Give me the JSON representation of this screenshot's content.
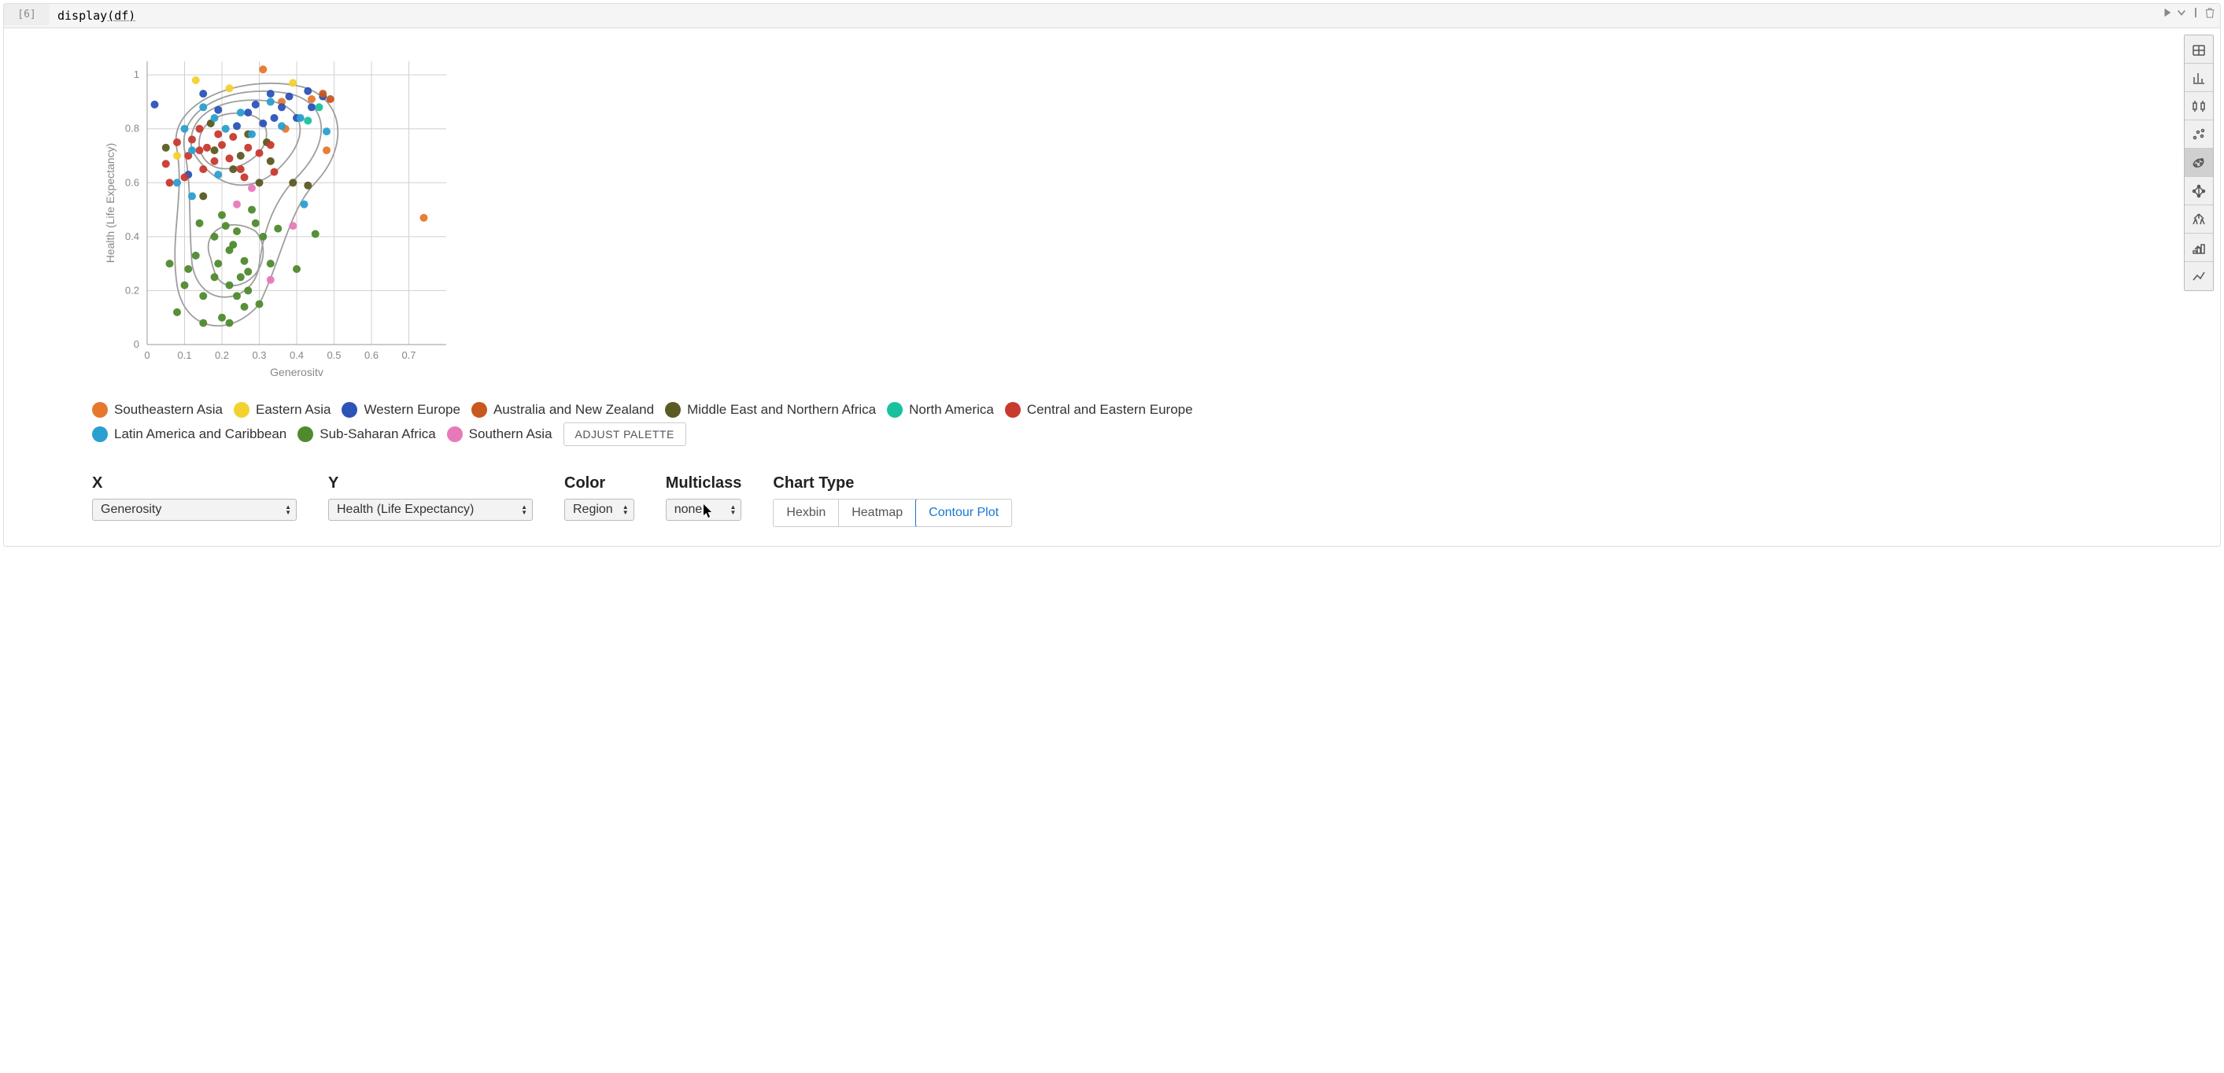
{
  "cell": {
    "prompt": "[6]",
    "code_pre": "display",
    "code_arg": "(df)"
  },
  "chart_data": {
    "type": "scatter",
    "xlabel": "Generositv",
    "ylabel": "Health (Life Expectancy)",
    "xlim": [
      0,
      0.8
    ],
    "ylim": [
      0,
      1.05
    ],
    "xticks": [
      0,
      0.1,
      0.2,
      0.3,
      0.4,
      0.5,
      0.6,
      0.7
    ],
    "yticks": [
      0,
      0.2,
      0.4,
      0.6,
      0.8,
      1
    ],
    "series": [
      {
        "name": "Southeastern Asia",
        "color": "#e6782e",
        "points": [
          [
            0.31,
            1.02
          ],
          [
            0.36,
            0.9
          ],
          [
            0.44,
            0.91
          ],
          [
            0.74,
            0.47
          ],
          [
            0.48,
            0.72
          ],
          [
            0.37,
            0.8
          ]
        ]
      },
      {
        "name": "Eastern Asia",
        "color": "#f2d22e",
        "points": [
          [
            0.13,
            0.98
          ],
          [
            0.08,
            0.7
          ],
          [
            0.39,
            0.97
          ],
          [
            0.22,
            0.95
          ]
        ]
      },
      {
        "name": "Western Europe",
        "color": "#2b53b8",
        "points": [
          [
            0.29,
            0.89
          ],
          [
            0.33,
            0.93
          ],
          [
            0.38,
            0.92
          ],
          [
            0.43,
            0.94
          ],
          [
            0.36,
            0.88
          ],
          [
            0.47,
            0.92
          ],
          [
            0.27,
            0.86
          ],
          [
            0.34,
            0.84
          ],
          [
            0.11,
            0.63
          ],
          [
            0.02,
            0.89
          ],
          [
            0.15,
            0.93
          ],
          [
            0.19,
            0.87
          ],
          [
            0.24,
            0.81
          ],
          [
            0.31,
            0.82
          ],
          [
            0.4,
            0.84
          ],
          [
            0.44,
            0.88
          ]
        ]
      },
      {
        "name": "Australia and New Zealand",
        "color": "#c9571e",
        "points": [
          [
            0.47,
            0.93
          ],
          [
            0.49,
            0.91
          ]
        ]
      },
      {
        "name": "Middle East and Northern Africa",
        "color": "#5b5a22",
        "points": [
          [
            0.17,
            0.82
          ],
          [
            0.15,
            0.55
          ],
          [
            0.32,
            0.75
          ],
          [
            0.25,
            0.7
          ],
          [
            0.39,
            0.6
          ],
          [
            0.3,
            0.6
          ],
          [
            0.23,
            0.65
          ],
          [
            0.18,
            0.72
          ],
          [
            0.27,
            0.78
          ],
          [
            0.43,
            0.59
          ],
          [
            0.33,
            0.68
          ],
          [
            0.05,
            0.73
          ]
        ]
      },
      {
        "name": "North America",
        "color": "#19c29d",
        "points": [
          [
            0.43,
            0.83
          ],
          [
            0.46,
            0.88
          ]
        ]
      },
      {
        "name": "Central and Eastern Europe",
        "color": "#c73a2e",
        "points": [
          [
            0.05,
            0.67
          ],
          [
            0.08,
            0.75
          ],
          [
            0.12,
            0.76
          ],
          [
            0.14,
            0.72
          ],
          [
            0.16,
            0.73
          ],
          [
            0.23,
            0.77
          ],
          [
            0.2,
            0.74
          ],
          [
            0.27,
            0.73
          ],
          [
            0.1,
            0.62
          ],
          [
            0.15,
            0.65
          ],
          [
            0.18,
            0.68
          ],
          [
            0.22,
            0.69
          ],
          [
            0.25,
            0.65
          ],
          [
            0.3,
            0.71
          ],
          [
            0.33,
            0.74
          ],
          [
            0.11,
            0.7
          ],
          [
            0.06,
            0.6
          ],
          [
            0.14,
            0.8
          ],
          [
            0.19,
            0.78
          ],
          [
            0.26,
            0.62
          ],
          [
            0.34,
            0.64
          ]
        ]
      },
      {
        "name": "Latin America and Caribbean",
        "color": "#2a9fd1",
        "points": [
          [
            0.1,
            0.8
          ],
          [
            0.15,
            0.88
          ],
          [
            0.18,
            0.84
          ],
          [
            0.08,
            0.6
          ],
          [
            0.12,
            0.55
          ],
          [
            0.25,
            0.86
          ],
          [
            0.33,
            0.9
          ],
          [
            0.19,
            0.63
          ],
          [
            0.28,
            0.78
          ],
          [
            0.36,
            0.81
          ],
          [
            0.48,
            0.79
          ],
          [
            0.41,
            0.84
          ],
          [
            0.42,
            0.52
          ],
          [
            0.12,
            0.72
          ],
          [
            0.21,
            0.8
          ]
        ]
      },
      {
        "name": "Sub-Saharan Africa",
        "color": "#4f8a2f",
        "points": [
          [
            0.19,
            0.3
          ],
          [
            0.22,
            0.35
          ],
          [
            0.26,
            0.31
          ],
          [
            0.24,
            0.42
          ],
          [
            0.18,
            0.25
          ],
          [
            0.15,
            0.18
          ],
          [
            0.29,
            0.45
          ],
          [
            0.33,
            0.3
          ],
          [
            0.3,
            0.15
          ],
          [
            0.2,
            0.1
          ],
          [
            0.08,
            0.12
          ],
          [
            0.1,
            0.22
          ],
          [
            0.13,
            0.33
          ],
          [
            0.27,
            0.2
          ],
          [
            0.31,
            0.4
          ],
          [
            0.35,
            0.43
          ],
          [
            0.4,
            0.28
          ],
          [
            0.45,
            0.41
          ],
          [
            0.22,
            0.08
          ],
          [
            0.25,
            0.25
          ],
          [
            0.18,
            0.4
          ],
          [
            0.21,
            0.44
          ],
          [
            0.23,
            0.37
          ],
          [
            0.26,
            0.14
          ],
          [
            0.11,
            0.28
          ],
          [
            0.14,
            0.45
          ],
          [
            0.28,
            0.5
          ],
          [
            0.2,
            0.48
          ],
          [
            0.24,
            0.18
          ],
          [
            0.27,
            0.27
          ],
          [
            0.22,
            0.22
          ],
          [
            0.15,
            0.08
          ],
          [
            0.06,
            0.3
          ]
        ]
      },
      {
        "name": "Southern Asia",
        "color": "#e879b9",
        "points": [
          [
            0.24,
            0.52
          ],
          [
            0.28,
            0.58
          ],
          [
            0.39,
            0.44
          ],
          [
            0.33,
            0.24
          ]
        ]
      }
    ],
    "contours": true
  },
  "legend": {
    "items": [
      {
        "label": "Southeastern Asia",
        "color": "#e6782e"
      },
      {
        "label": "Eastern Asia",
        "color": "#f2d22e"
      },
      {
        "label": "Western Europe",
        "color": "#2b53b8"
      },
      {
        "label": "Australia and New Zealand",
        "color": "#c9571e"
      },
      {
        "label": "Middle East and Northern Africa",
        "color": "#5b5a22"
      },
      {
        "label": "North America",
        "color": "#19c29d"
      },
      {
        "label": "Central and Eastern Europe",
        "color": "#c73a2e"
      },
      {
        "label": "Latin America and Caribbean",
        "color": "#2a9fd1"
      },
      {
        "label": "Sub-Saharan Africa",
        "color": "#4f8a2f"
      },
      {
        "label": "Southern Asia",
        "color": "#e879b9"
      }
    ],
    "adjust_label": "ADJUST PALETTE"
  },
  "controls": {
    "x_label": "X",
    "x_value": "Generosity",
    "y_label": "Y",
    "y_value": "Health (Life Expectancy)",
    "color_label": "Color",
    "color_value": "Region",
    "multiclass_label": "Multiclass",
    "multiclass_value": "none",
    "chart_type_label": "Chart Type",
    "chart_types": [
      "Hexbin",
      "Heatmap",
      "Contour Plot"
    ],
    "chart_type_selected": "Contour Plot"
  },
  "toolbar": {
    "items": [
      {
        "name": "data-table-icon"
      },
      {
        "name": "bar-chart-icon"
      },
      {
        "name": "boxplot-icon"
      },
      {
        "name": "scatter-icon"
      },
      {
        "name": "contour-scatter-icon"
      },
      {
        "name": "network-icon"
      },
      {
        "name": "tree-icon"
      },
      {
        "name": "ranking-icon"
      },
      {
        "name": "line-chart-icon"
      }
    ],
    "active_index": 4
  }
}
